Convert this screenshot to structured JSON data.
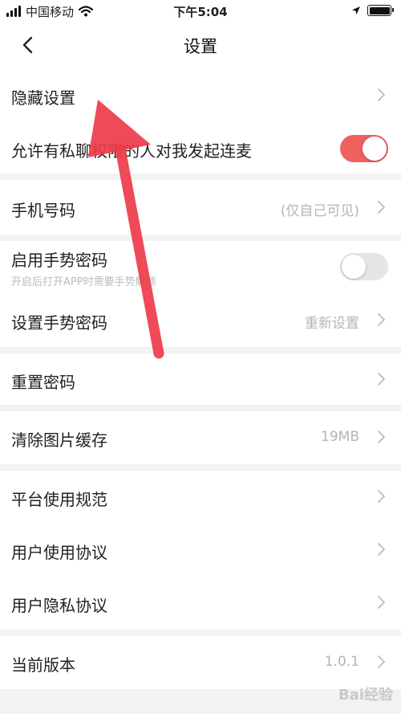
{
  "status_bar": {
    "carrier": "中国移动",
    "time": "下午5:04"
  },
  "nav": {
    "title": "设置"
  },
  "rows": {
    "hidden_settings": {
      "label": "隐藏设置"
    },
    "allow_mic": {
      "label": "允许有私聊权限的人对我发起连麦",
      "toggle": "on"
    },
    "phone": {
      "label": "手机号码",
      "value": "(仅自己可见)"
    },
    "gesture_enable": {
      "label": "启用手势密码",
      "sub": "开启后打开APP时需要手势解锁",
      "toggle": "off"
    },
    "gesture_set": {
      "label": "设置手势密码",
      "value": "重新设置"
    },
    "reset_password": {
      "label": "重置密码"
    },
    "clear_cache": {
      "label": "清除图片缓存",
      "value": "19MB"
    },
    "platform_rules": {
      "label": "平台使用规范"
    },
    "user_agreement": {
      "label": "用户使用协议"
    },
    "privacy_agreement": {
      "label": "用户隐私协议"
    },
    "version": {
      "label": "当前版本",
      "value": "1.0.1"
    }
  },
  "watermark": "Bai经验",
  "colors": {
    "accent": "#f06060",
    "arrow": "#ee3b4a"
  }
}
